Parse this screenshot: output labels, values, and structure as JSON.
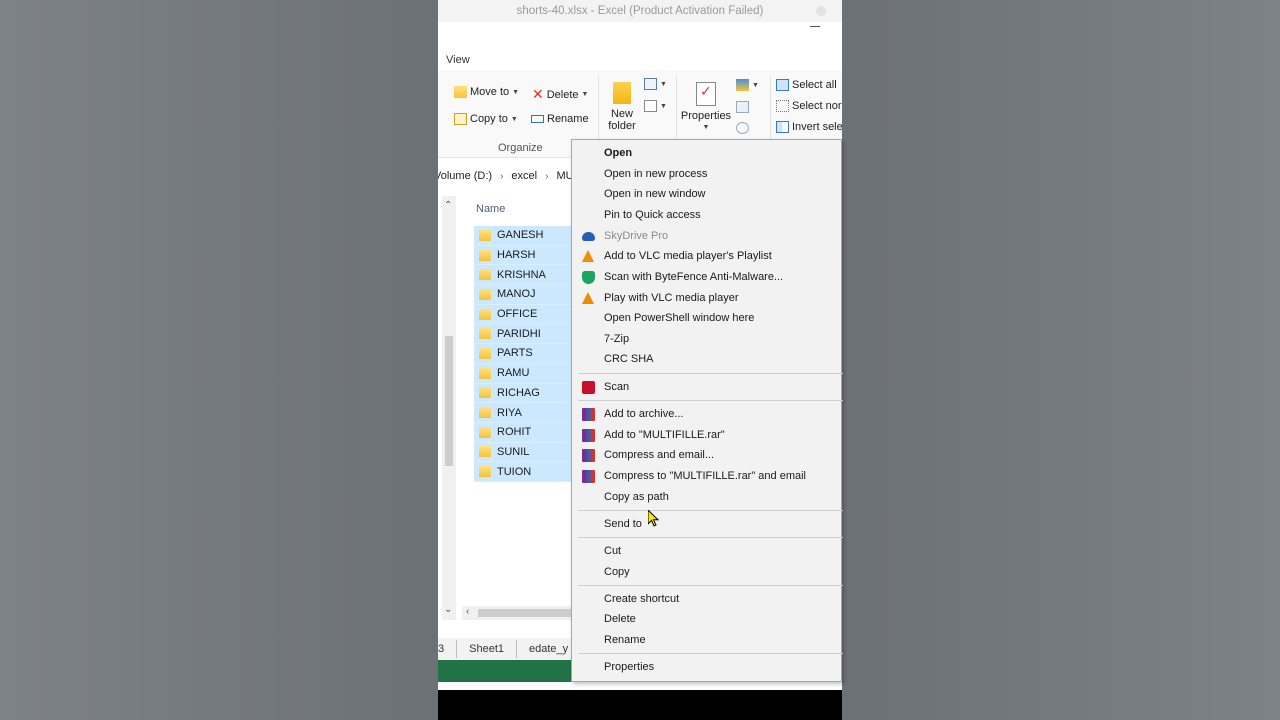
{
  "window": {
    "title": "shorts-40.xlsx - Excel (Product Activation Failed)"
  },
  "ribbon": {
    "tab": "View",
    "move_to": "Move to",
    "delete": "Delete",
    "copy_to": "Copy to",
    "rename": "Rename",
    "new_folder_line1": "New",
    "new_folder_line2": "folder",
    "properties": "Properties",
    "select_all": "Select all",
    "select_none": "Select nor",
    "invert_selection": "Invert sele",
    "group_organize": "Organize"
  },
  "address": {
    "parts": [
      "Volume (D:)",
      "excel",
      "MU"
    ]
  },
  "file_list": {
    "column_name": "Name",
    "folders": [
      "GANESH",
      "HARSH",
      "KRISHNA",
      "MANOJ",
      "OFFICE",
      "PARIDHI",
      "PARTS",
      "RAMU",
      "RICHAG",
      "RIYA",
      "ROHIT",
      "SUNIL",
      "TUION"
    ]
  },
  "sheets": {
    "tabs": [
      "3",
      "Sheet1",
      "edate_y"
    ]
  },
  "context_menu": {
    "open": "Open",
    "open_new_process": "Open in new process",
    "open_new_window": "Open in new window",
    "pin_quick_access": "Pin to Quick access",
    "skydrive_pro": "SkyDrive Pro",
    "add_vlc_playlist": "Add to VLC media player's Playlist",
    "scan_bytefence": "Scan with ByteFence Anti-Malware...",
    "play_vlc": "Play with VLC media player",
    "open_powershell": "Open PowerShell window here",
    "seven_zip": "7-Zip",
    "crc_sha": "CRC SHA",
    "scan": "Scan",
    "add_archive": "Add to archive...",
    "add_to_rar": "Add to \"MULTIFILLE.rar\"",
    "compress_email": "Compress and email...",
    "compress_rar_email": "Compress to \"MULTIFILLE.rar\" and email",
    "copy_as_path": "Copy as path",
    "send_to": "Send to",
    "cut": "Cut",
    "copy": "Copy",
    "create_shortcut": "Create shortcut",
    "delete": "Delete",
    "rename": "Rename",
    "properties": "Properties"
  }
}
